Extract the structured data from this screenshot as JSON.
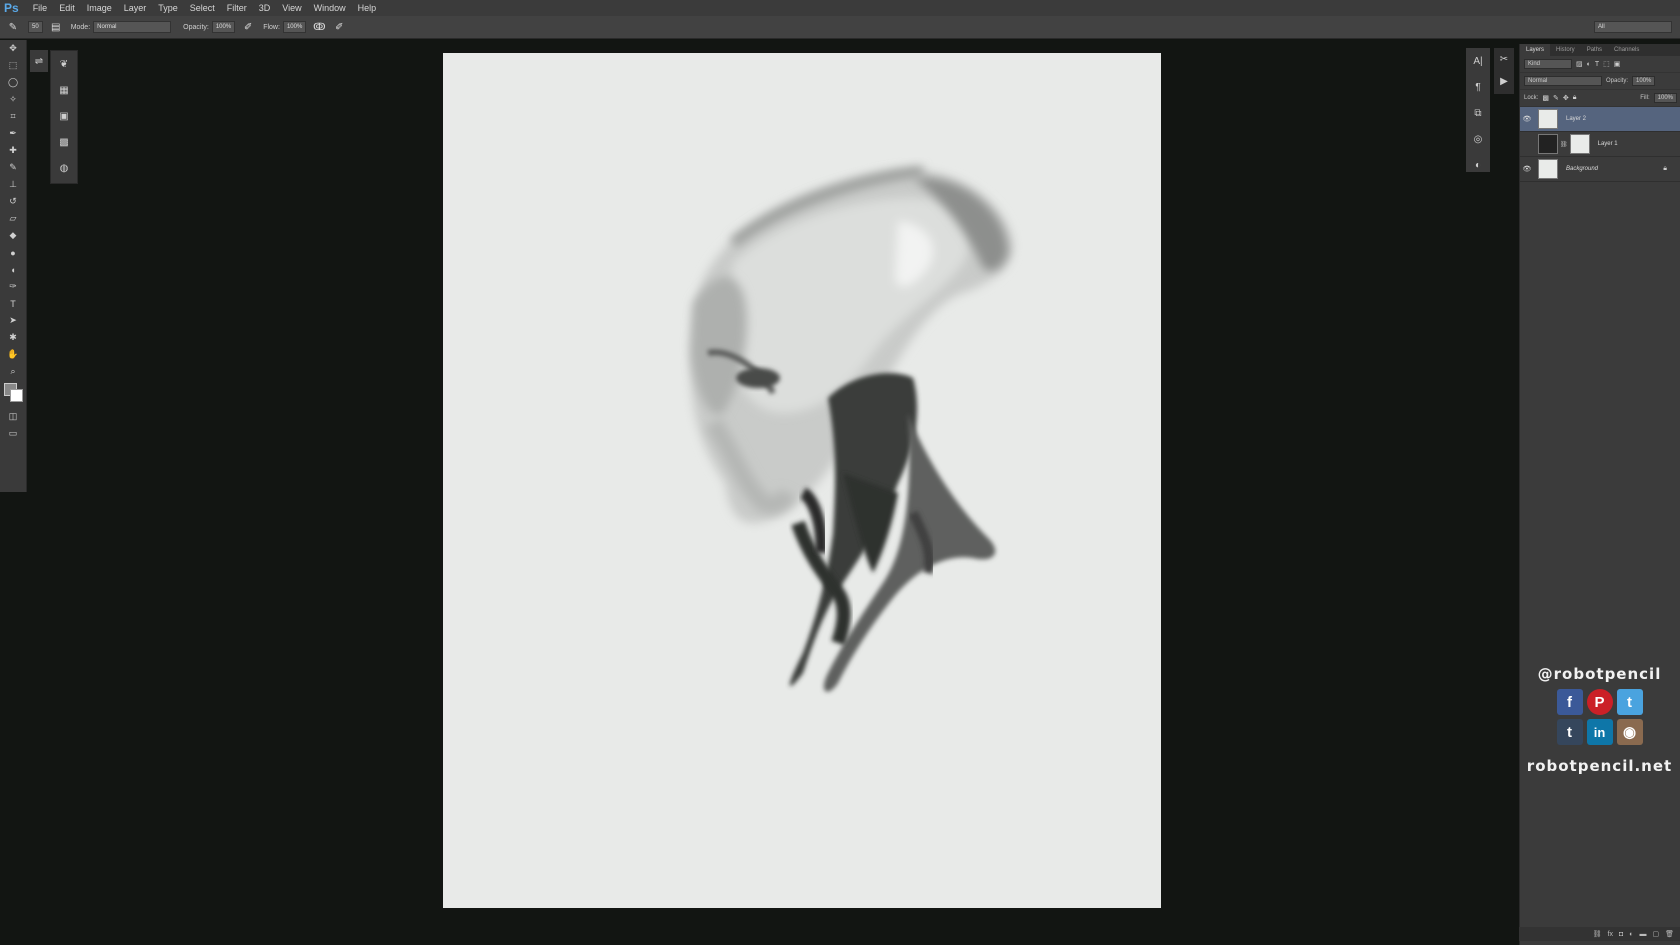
{
  "app": {
    "logo": "Ps"
  },
  "menu": [
    "File",
    "Edit",
    "Image",
    "Layer",
    "Type",
    "Select",
    "Filter",
    "3D",
    "View",
    "Window",
    "Help"
  ],
  "options": {
    "brush_size": "50",
    "mode_label": "Mode:",
    "mode_value": "Normal",
    "opacity_label": "Opacity:",
    "opacity_value": "100%",
    "flow_label": "Flow:",
    "flow_value": "100%",
    "workspace": "All"
  },
  "layers_panel": {
    "tabs": [
      "Layers",
      "History",
      "Paths",
      "Channels"
    ],
    "filter_kind": "Kind",
    "blend_mode": "Normal",
    "opacity_label": "Opacity:",
    "opacity_value": "100%",
    "lock_label": "Lock:",
    "fill_label": "Fill:",
    "fill_value": "100%",
    "layers": [
      {
        "name": "Layer 2",
        "visible": true,
        "selected": true
      },
      {
        "name": "Layer 1",
        "visible": false,
        "selected": false
      },
      {
        "name": "Background",
        "visible": true,
        "selected": false,
        "locked": true
      }
    ]
  },
  "promo": {
    "handle": "@robotpencil",
    "site": "robotpencil.net",
    "icons": [
      {
        "name": "facebook",
        "glyph": "f",
        "color": "#3b5998"
      },
      {
        "name": "pinterest",
        "glyph": "P",
        "color": "#cb2027"
      },
      {
        "name": "twitter",
        "glyph": "t",
        "color": "#4aa3df"
      },
      {
        "name": "tumblr",
        "glyph": "t",
        "color": "#35465c"
      },
      {
        "name": "linkedin",
        "glyph": "in",
        "color": "#0e76a8"
      },
      {
        "name": "instagram",
        "glyph": "◉",
        "color": "#8a6a4f"
      }
    ]
  }
}
